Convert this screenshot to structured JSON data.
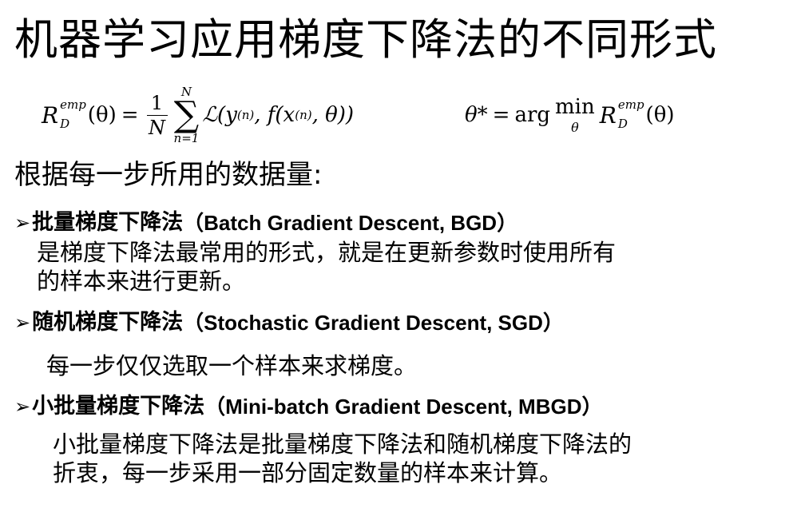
{
  "title": "机器学习应用梯度下降法的不同形式",
  "formula": {
    "risk_symbol": "R",
    "emp": "emp",
    "D": "D",
    "theta_paren": "(θ)",
    "equals": "=",
    "frac_num": "1",
    "frac_den": "N",
    "sum_top": "N",
    "sum_sym": "∑",
    "sum_bottom": "n=1",
    "loss": "ℒ(y",
    "n_sup": "(n)",
    "f_part": ", f(x",
    "tail": ", θ))",
    "theta_star": "θ*",
    "arg": "arg",
    "min": "min",
    "min_under": "θ"
  },
  "subheading": "根据每一步所用的数据量:",
  "arrow": "➢",
  "items": [
    {
      "heading_cn": "批量梯度下降法",
      "heading_en": "（Batch Gradient Descent, BGD）",
      "desc_lines": [
        "是梯度下降法最常用的形式，就是在更新参数时使用所有",
        "的样本来进行更新。"
      ]
    },
    {
      "heading_cn": "随机梯度下降法",
      "heading_en": "（Stochastic Gradient Descent, SGD）",
      "desc_lines": [
        "每一步仅仅选取一个样本来求梯度。"
      ]
    },
    {
      "heading_cn": "小批量梯度下降法",
      "heading_en": "（Mini-batch Gradient Descent, MBGD）",
      "desc_lines": [
        "小批量梯度下降法是批量梯度下降法和随机梯度下降法的",
        "折衷，每一步采用一部分固定数量的样本来计算。"
      ]
    }
  ]
}
